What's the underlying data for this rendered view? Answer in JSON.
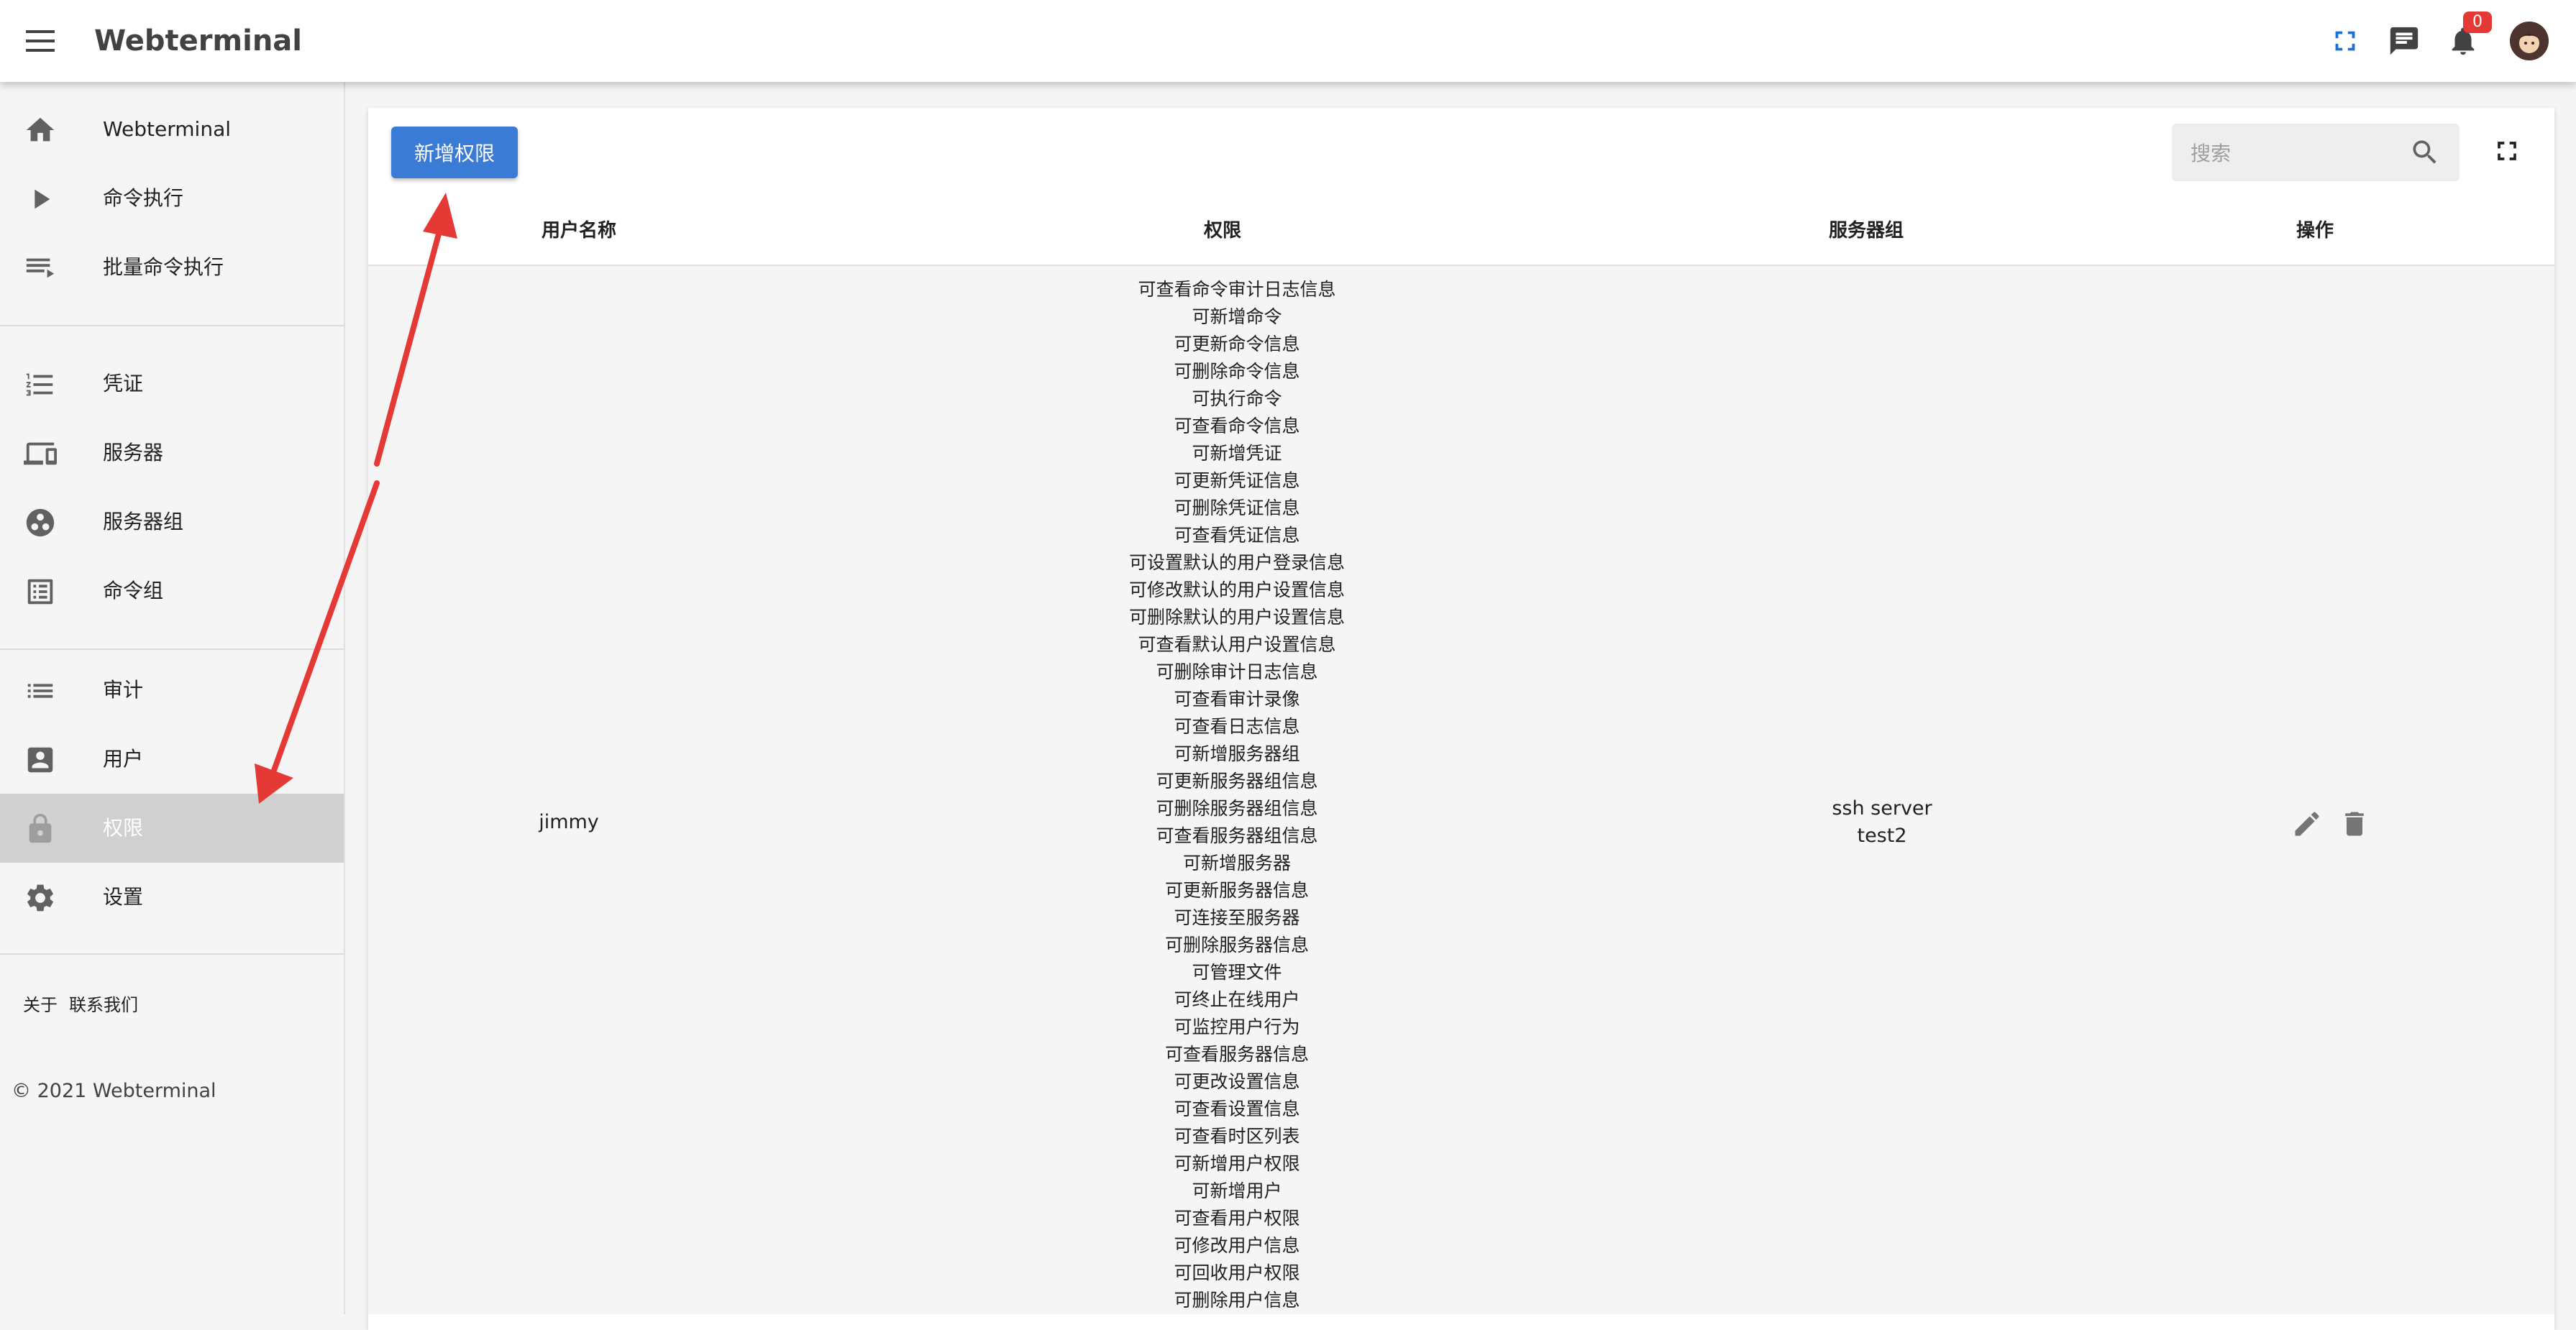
{
  "appbar": {
    "title": "Webterminal",
    "notification_count": "0",
    "icons": [
      "menu-icon",
      "fullscreen-icon",
      "message-icon",
      "bell-icon",
      "avatar"
    ]
  },
  "sidebar": {
    "groups": [
      [
        {
          "label": "Webterminal",
          "icon": "home-icon"
        },
        {
          "label": "命令执行",
          "icon": "play-icon"
        },
        {
          "label": "批量命令执行",
          "icon": "playlist-play-icon"
        }
      ],
      [
        {
          "label": "凭证",
          "icon": "list-numbered-icon"
        },
        {
          "label": "服务器",
          "icon": "devices-icon"
        },
        {
          "label": "服务器组",
          "icon": "workspaces-icon"
        },
        {
          "label": "命令组",
          "icon": "list-box-icon"
        }
      ],
      [
        {
          "label": "审计",
          "icon": "list-icon"
        },
        {
          "label": "用户",
          "icon": "account-box-icon"
        },
        {
          "label": "权限",
          "icon": "lock-icon",
          "active": true
        },
        {
          "label": "设置",
          "icon": "gear-icon"
        }
      ]
    ],
    "footer_links": [
      "关于",
      "联系我们"
    ],
    "copyright": "© 2021 Webterminal"
  },
  "toolbar": {
    "add_button": "新增权限",
    "search_placeholder": "搜索"
  },
  "table": {
    "columns": [
      "用户名称",
      "权限",
      "服务器组",
      "操作"
    ],
    "rows": [
      {
        "username": "jimmy",
        "permissions": [
          "可查看命令审计日志信息",
          "可新增命令",
          "可更新命令信息",
          "可删除命令信息",
          "可执行命令",
          "可查看命令信息",
          "可新增凭证",
          "可更新凭证信息",
          "可删除凭证信息",
          "可查看凭证信息",
          "可设置默认的用户登录信息",
          "可修改默认的用户设置信息",
          "可删除默认的用户设置信息",
          "可查看默认用户设置信息",
          "可删除审计日志信息",
          "可查看审计录像",
          "可查看日志信息",
          "可新增服务器组",
          "可更新服务器组信息",
          "可删除服务器组信息",
          "可查看服务器组信息",
          "可新增服务器",
          "可更新服务器信息",
          "可连接至服务器",
          "可删除服务器信息",
          "可管理文件",
          "可终止在线用户",
          "可监控用户行为",
          "可查看服务器信息",
          "可更改设置信息",
          "可查看设置信息",
          "可查看时区列表",
          "可新增用户权限",
          "可新增用户",
          "可查看用户权限",
          "可修改用户信息",
          "可回收用户权限",
          "可删除用户信息"
        ],
        "server_groups": [
          "ssh server",
          "test2"
        ],
        "actions": [
          "edit-icon",
          "delete-icon"
        ]
      }
    ]
  },
  "colors": {
    "primary_button": "#3a7bd5",
    "annotation_arrow": "#e53935",
    "badge": "#e53935",
    "active_nav_bg": "#d0d0d0"
  }
}
